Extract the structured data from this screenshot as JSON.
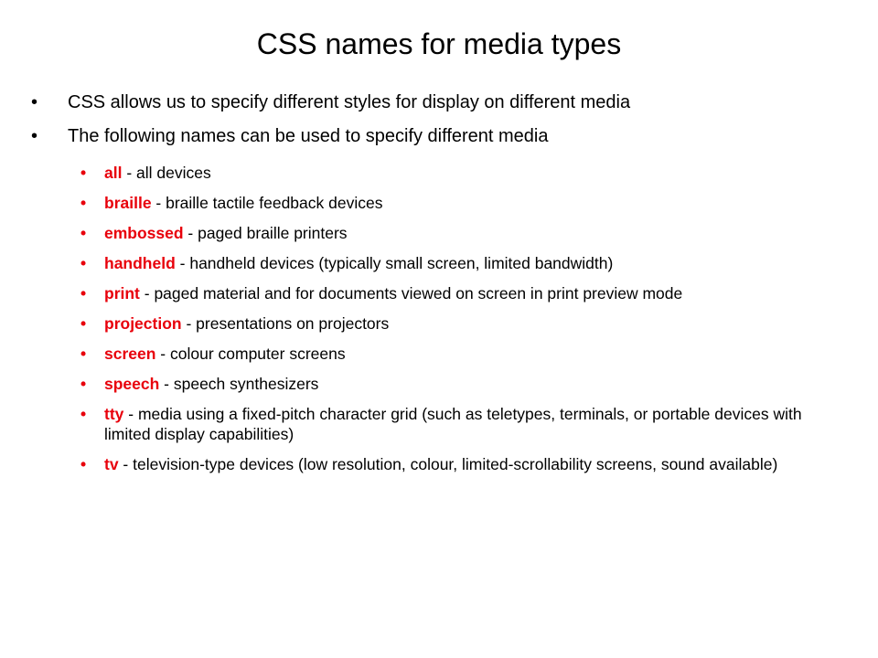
{
  "slide": {
    "title": "CSS names for media types",
    "bullet_char": "•",
    "accent_color": "#e8000b",
    "points": [
      "CSS allows us to specify different styles for display on different media",
      "The following names can be used to specify different media"
    ],
    "media_types": [
      {
        "term": "all",
        "description": " - all devices"
      },
      {
        "term": "braille",
        "description": " - braille tactile feedback devices"
      },
      {
        "term": "embossed",
        "description": " - paged braille printers"
      },
      {
        "term": "handheld",
        "description": " - handheld devices (typically small screen, limited bandwidth)"
      },
      {
        "term": "print",
        "description": " - paged material and for documents viewed on screen in print preview mode"
      },
      {
        "term": "projection",
        "description": " - presentations on projectors"
      },
      {
        "term": "screen",
        "description": " - colour computer screens"
      },
      {
        "term": "speech",
        "description": " - speech synthesizers"
      },
      {
        "term": "tty",
        "description": " - media using a fixed-pitch character grid (such as teletypes, terminals, or portable devices with limited display capabilities)"
      },
      {
        "term": "tv",
        "description": " - television-type devices (low resolution, colour, limited-scrollability screens, sound available)"
      }
    ]
  }
}
